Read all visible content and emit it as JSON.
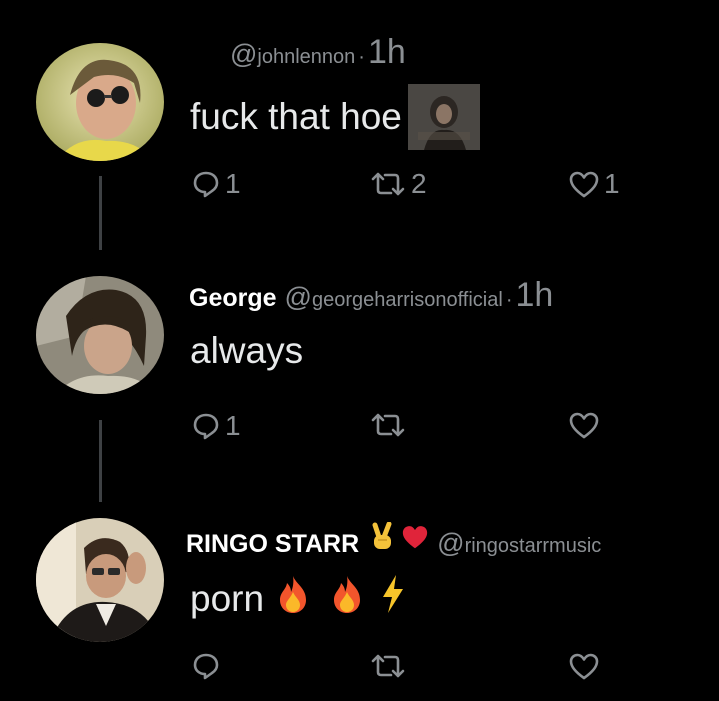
{
  "replies": [
    {
      "display_name": "",
      "handle": "johnlennon",
      "time": "1h",
      "text": "fuck that hoe",
      "has_image": true,
      "reply_count": "1",
      "repost_count": "2",
      "like_count": "1"
    },
    {
      "display_name": "George",
      "handle": "georgeharrisonofficial",
      "time": "1h",
      "text": "always",
      "reply_count": "1",
      "repost_count": "",
      "like_count": ""
    },
    {
      "display_name": "RINGO STARR",
      "name_emojis": [
        "victory-hand-emoji",
        "red-heart-emoji"
      ],
      "handle": "ringostarrmusic",
      "time": "",
      "text": "porn",
      "text_emojis": [
        "fire-emoji",
        "fire-emoji",
        "lightning-emoji"
      ],
      "reply_count": "",
      "repost_count": "",
      "like_count": ""
    }
  ],
  "icons": {
    "reply": "reply-icon",
    "repost": "repost-icon",
    "like": "like-icon"
  },
  "colors": {
    "background": "#000000",
    "text": "#e7e9ea",
    "muted": "#8b8f93",
    "thread_line": "#3e4144"
  }
}
